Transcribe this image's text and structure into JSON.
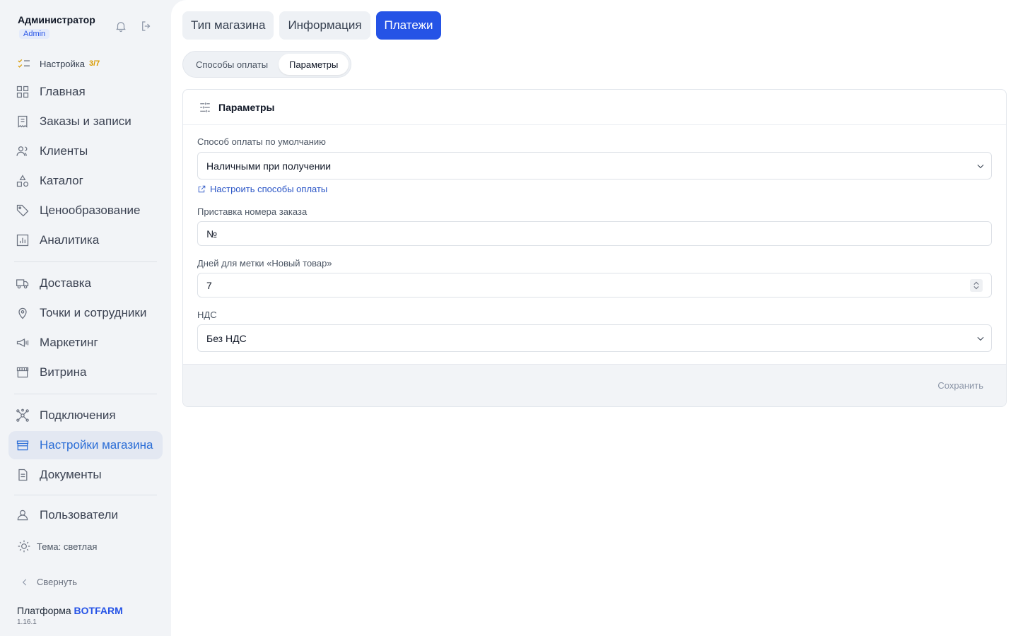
{
  "user": {
    "name": "Администратор",
    "role": "Admin"
  },
  "setup": {
    "label": "Настройка",
    "count": "3/7"
  },
  "nav_primary": [
    {
      "label": "Главная"
    },
    {
      "label": "Заказы и записи"
    },
    {
      "label": "Клиенты"
    },
    {
      "label": "Каталог"
    },
    {
      "label": "Ценообразование"
    },
    {
      "label": "Аналитика"
    }
  ],
  "nav_secondary": [
    {
      "label": "Доставка"
    },
    {
      "label": "Точки и сотрудники"
    },
    {
      "label": "Маркетинг"
    },
    {
      "label": "Витрина"
    }
  ],
  "nav_tertiary": [
    {
      "label": "Подключения"
    },
    {
      "label": "Настройки магазина",
      "active": true
    },
    {
      "label": "Документы"
    }
  ],
  "nav_users": {
    "label": "Пользователи"
  },
  "theme": {
    "label": "Тема: светлая"
  },
  "collapse": {
    "label": "Свернуть"
  },
  "brand": {
    "prefix": "Платформа",
    "name": "BOTFARM",
    "version": "1.16.1"
  },
  "tabs": [
    {
      "label": "Тип магазина"
    },
    {
      "label": "Информация"
    },
    {
      "label": "Платежи",
      "active": true
    }
  ],
  "subtabs": [
    {
      "label": "Способы оплаты"
    },
    {
      "label": "Параметры",
      "active": true
    }
  ],
  "card": {
    "title": "Параметры",
    "default_payment": {
      "label": "Способ оплаты по умолчанию",
      "value": "Наличными при получении"
    },
    "configure_link": "Настроить способы оплаты",
    "order_prefix": {
      "label": "Приставка номера заказа",
      "value": "№"
    },
    "new_days": {
      "label": "Дней для метки «Новый товар»",
      "value": "7"
    },
    "vat": {
      "label": "НДС",
      "value": "Без НДС"
    },
    "save": "Сохранить"
  },
  "colors": {
    "accent": "#2553e6",
    "active_nav": "#2a6dd6",
    "setup_count": "#d99a00"
  }
}
